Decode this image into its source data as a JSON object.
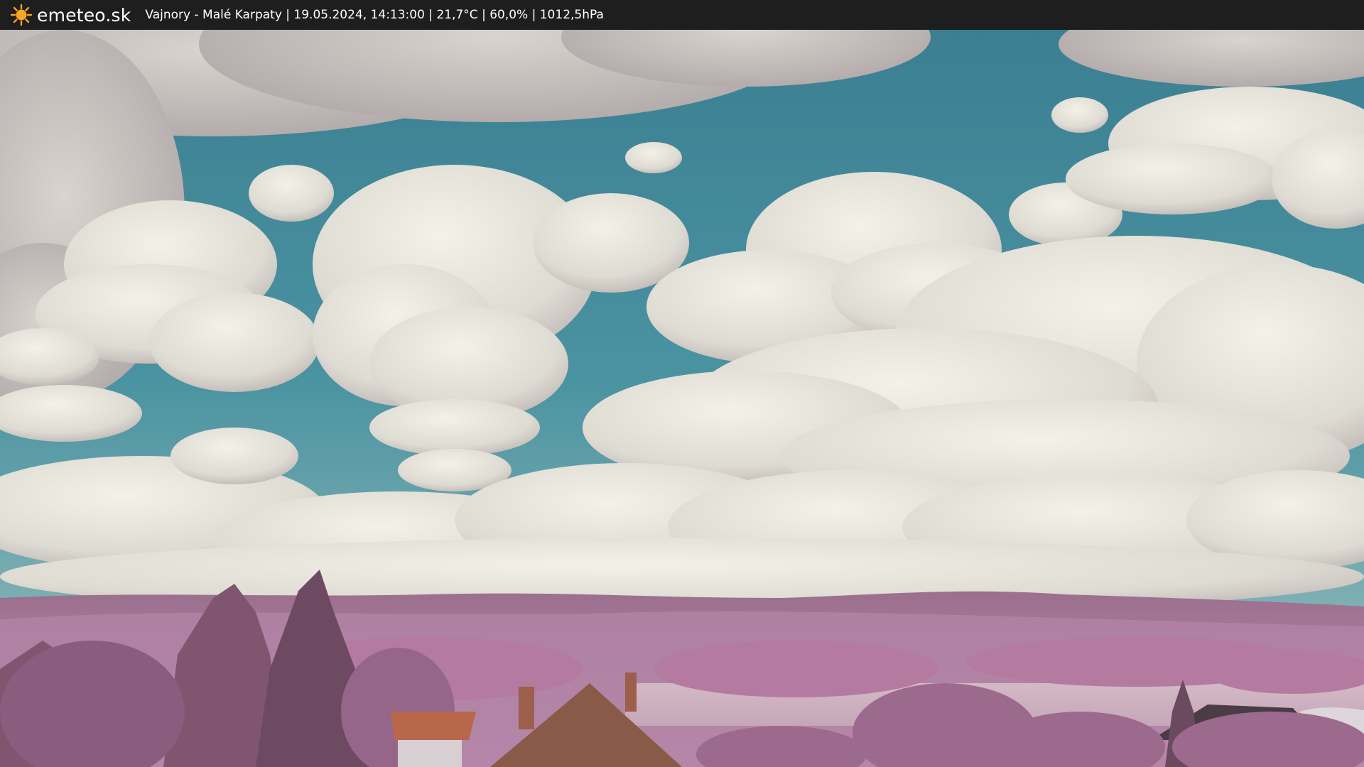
{
  "header": {
    "logo_text": "emeteo.sk",
    "logo_icon": "sun-icon",
    "caption": "Vajnory - Malé Karpaty | 19.05.2024, 14:13:00 | 21,7°C | 60,0% | 1012,5hPa"
  },
  "colors": {
    "bar": "#1e1e1e",
    "sun": "#f5a623",
    "sky": "#3f8a9a",
    "cloud": "#e8e6df",
    "vegetation": "#b07c9e",
    "roof": "#8a5a48"
  }
}
